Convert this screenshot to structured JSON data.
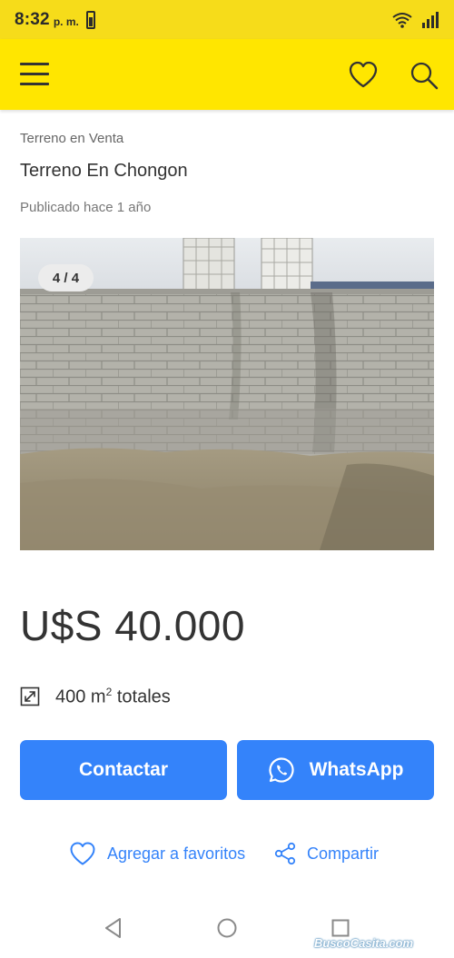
{
  "status_bar": {
    "time": "8:32",
    "ampm": "p. m."
  },
  "listing": {
    "category": "Terreno en Venta",
    "title": "Terreno En Chongon",
    "published": "Publicado hace 1 año",
    "image_counter": "4 / 4",
    "price": "U$S 40.000",
    "area_value": "400 m",
    "area_sup": "2",
    "area_suffix": " totales"
  },
  "actions": {
    "contact_label": "Contactar",
    "whatsapp_label": "WhatsApp",
    "favorite_label": "Agregar a favoritos",
    "share_label": "Compartir"
  },
  "watermark": "BuscoCasita.com",
  "colors": {
    "header_yellow": "#ffe600",
    "accent_blue": "#3483fa"
  },
  "icons": [
    "battery-icon",
    "wifi-icon",
    "signal-icon",
    "menu-icon",
    "heart-icon",
    "search-icon",
    "area-icon",
    "whatsapp-icon",
    "share-icon",
    "back-icon",
    "home-icon",
    "recents-icon"
  ]
}
